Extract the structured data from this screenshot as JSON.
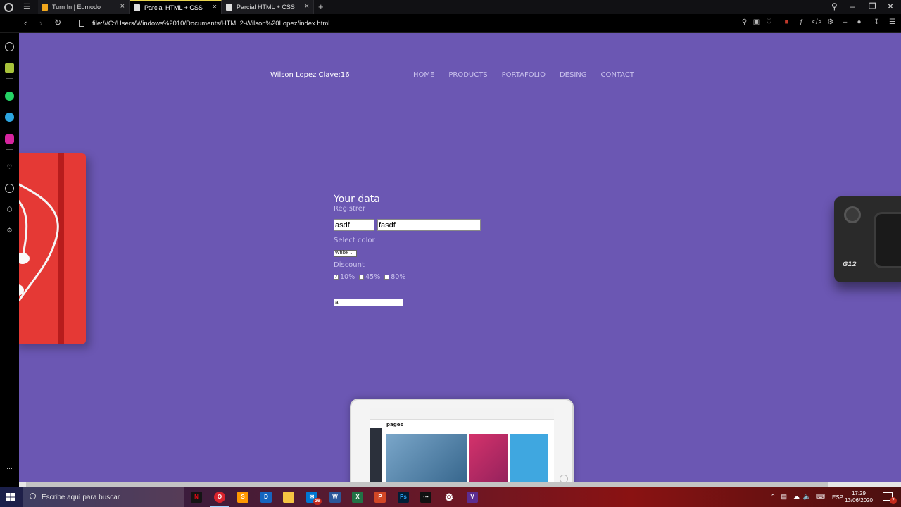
{
  "browser": {
    "tabs": [
      {
        "label": "Turn In | Edmodo",
        "icon": "edmodo-icon",
        "active": false
      },
      {
        "label": "Parcial HTML + CSS",
        "icon": "page-icon",
        "active": true
      },
      {
        "label": "Parcial HTML + CSS",
        "icon": "page-icon",
        "active": false
      }
    ],
    "new_tab": "+",
    "url": "file:///C:/Users/Windows%2010/Documents/HTML2-Wilson%20Lopez/index.html"
  },
  "header": {
    "brand": "Wilson Lopez Clave:16",
    "nav": [
      "HOME",
      "PRODUCTS",
      "PORTAFOLIO",
      "DESING",
      "CONTACT"
    ]
  },
  "form": {
    "title": "Your data",
    "subtitle": "Registrer",
    "first_value": "asdf",
    "last_value": "fasdf",
    "color_label": "Select color",
    "color_selected": "White",
    "discount_label": "Discount",
    "discounts": [
      {
        "label": "10%",
        "checked": true
      },
      {
        "label": "45%",
        "checked": false
      },
      {
        "label": "80%",
        "checked": false
      }
    ],
    "extra_value": "a"
  },
  "decor": {
    "camera_label": "G12",
    "tablet_brand": "pages"
  },
  "taskbar": {
    "search_placeholder": "Escribe aquí para buscar",
    "mail_badge": "36",
    "language": "ESP",
    "time": "17:29",
    "date": "13/06/2020",
    "notifications": "2"
  },
  "colors": {
    "page_bg": "#6b57b3",
    "nav_text": "#c9c1ec",
    "notebook": "#e53935"
  }
}
